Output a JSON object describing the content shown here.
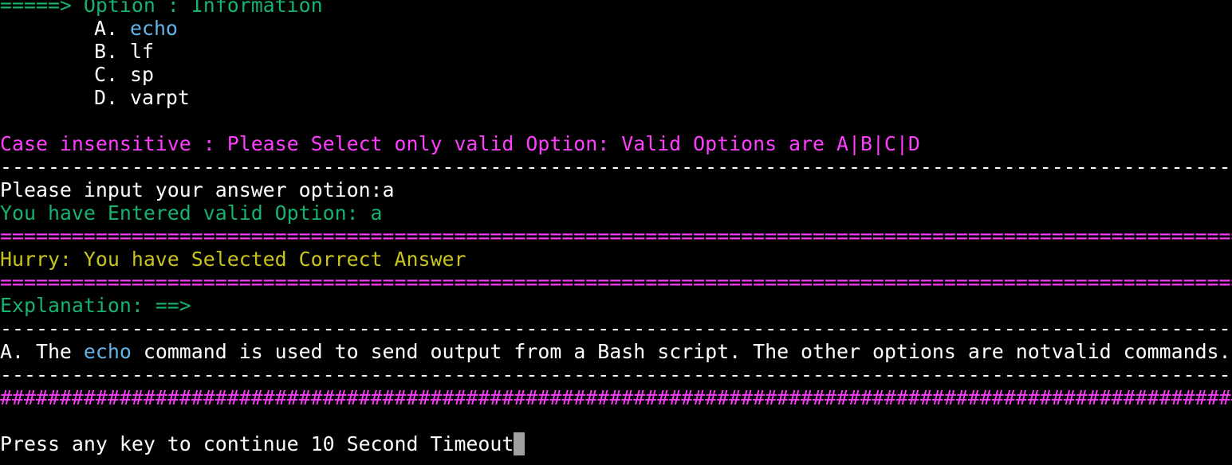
{
  "header": {
    "option_line": "=====> Option : Information"
  },
  "options": [
    {
      "letter": "A. ",
      "text": "echo"
    },
    {
      "letter": "B. ",
      "text": "lf"
    },
    {
      "letter": "C. ",
      "text": "sp"
    },
    {
      "letter": "D. ",
      "text": "varpt"
    }
  ],
  "notice": "Case insensitive : Please Select only valid Option: Valid Options are A|B|C|D",
  "prompt": {
    "label": "Please input your answer option:",
    "value": "a"
  },
  "validation": "You have Entered valid Option: a",
  "result": "Hurry: You have Selected Correct Answer",
  "explanation_header": "Explanation: ==>",
  "explanation": {
    "prefix": "A. The ",
    "keyword": "echo",
    "rest": " command is used to send output from a Bash script. The other options are notvalid commands."
  },
  "footer": "Press any key to continue 10 Second Timeout",
  "rules": {
    "dash": "----------------------------------------------------------------------------------------------------------------",
    "equals": "================================================================================================================",
    "hash": "################################################################################################################"
  },
  "colors": {
    "background": "#000000",
    "text": "#ffffff",
    "green": "#17b26d",
    "magenta": "#ff3dff",
    "yellow": "#c9c41c",
    "keyword": "#62b4e8"
  }
}
